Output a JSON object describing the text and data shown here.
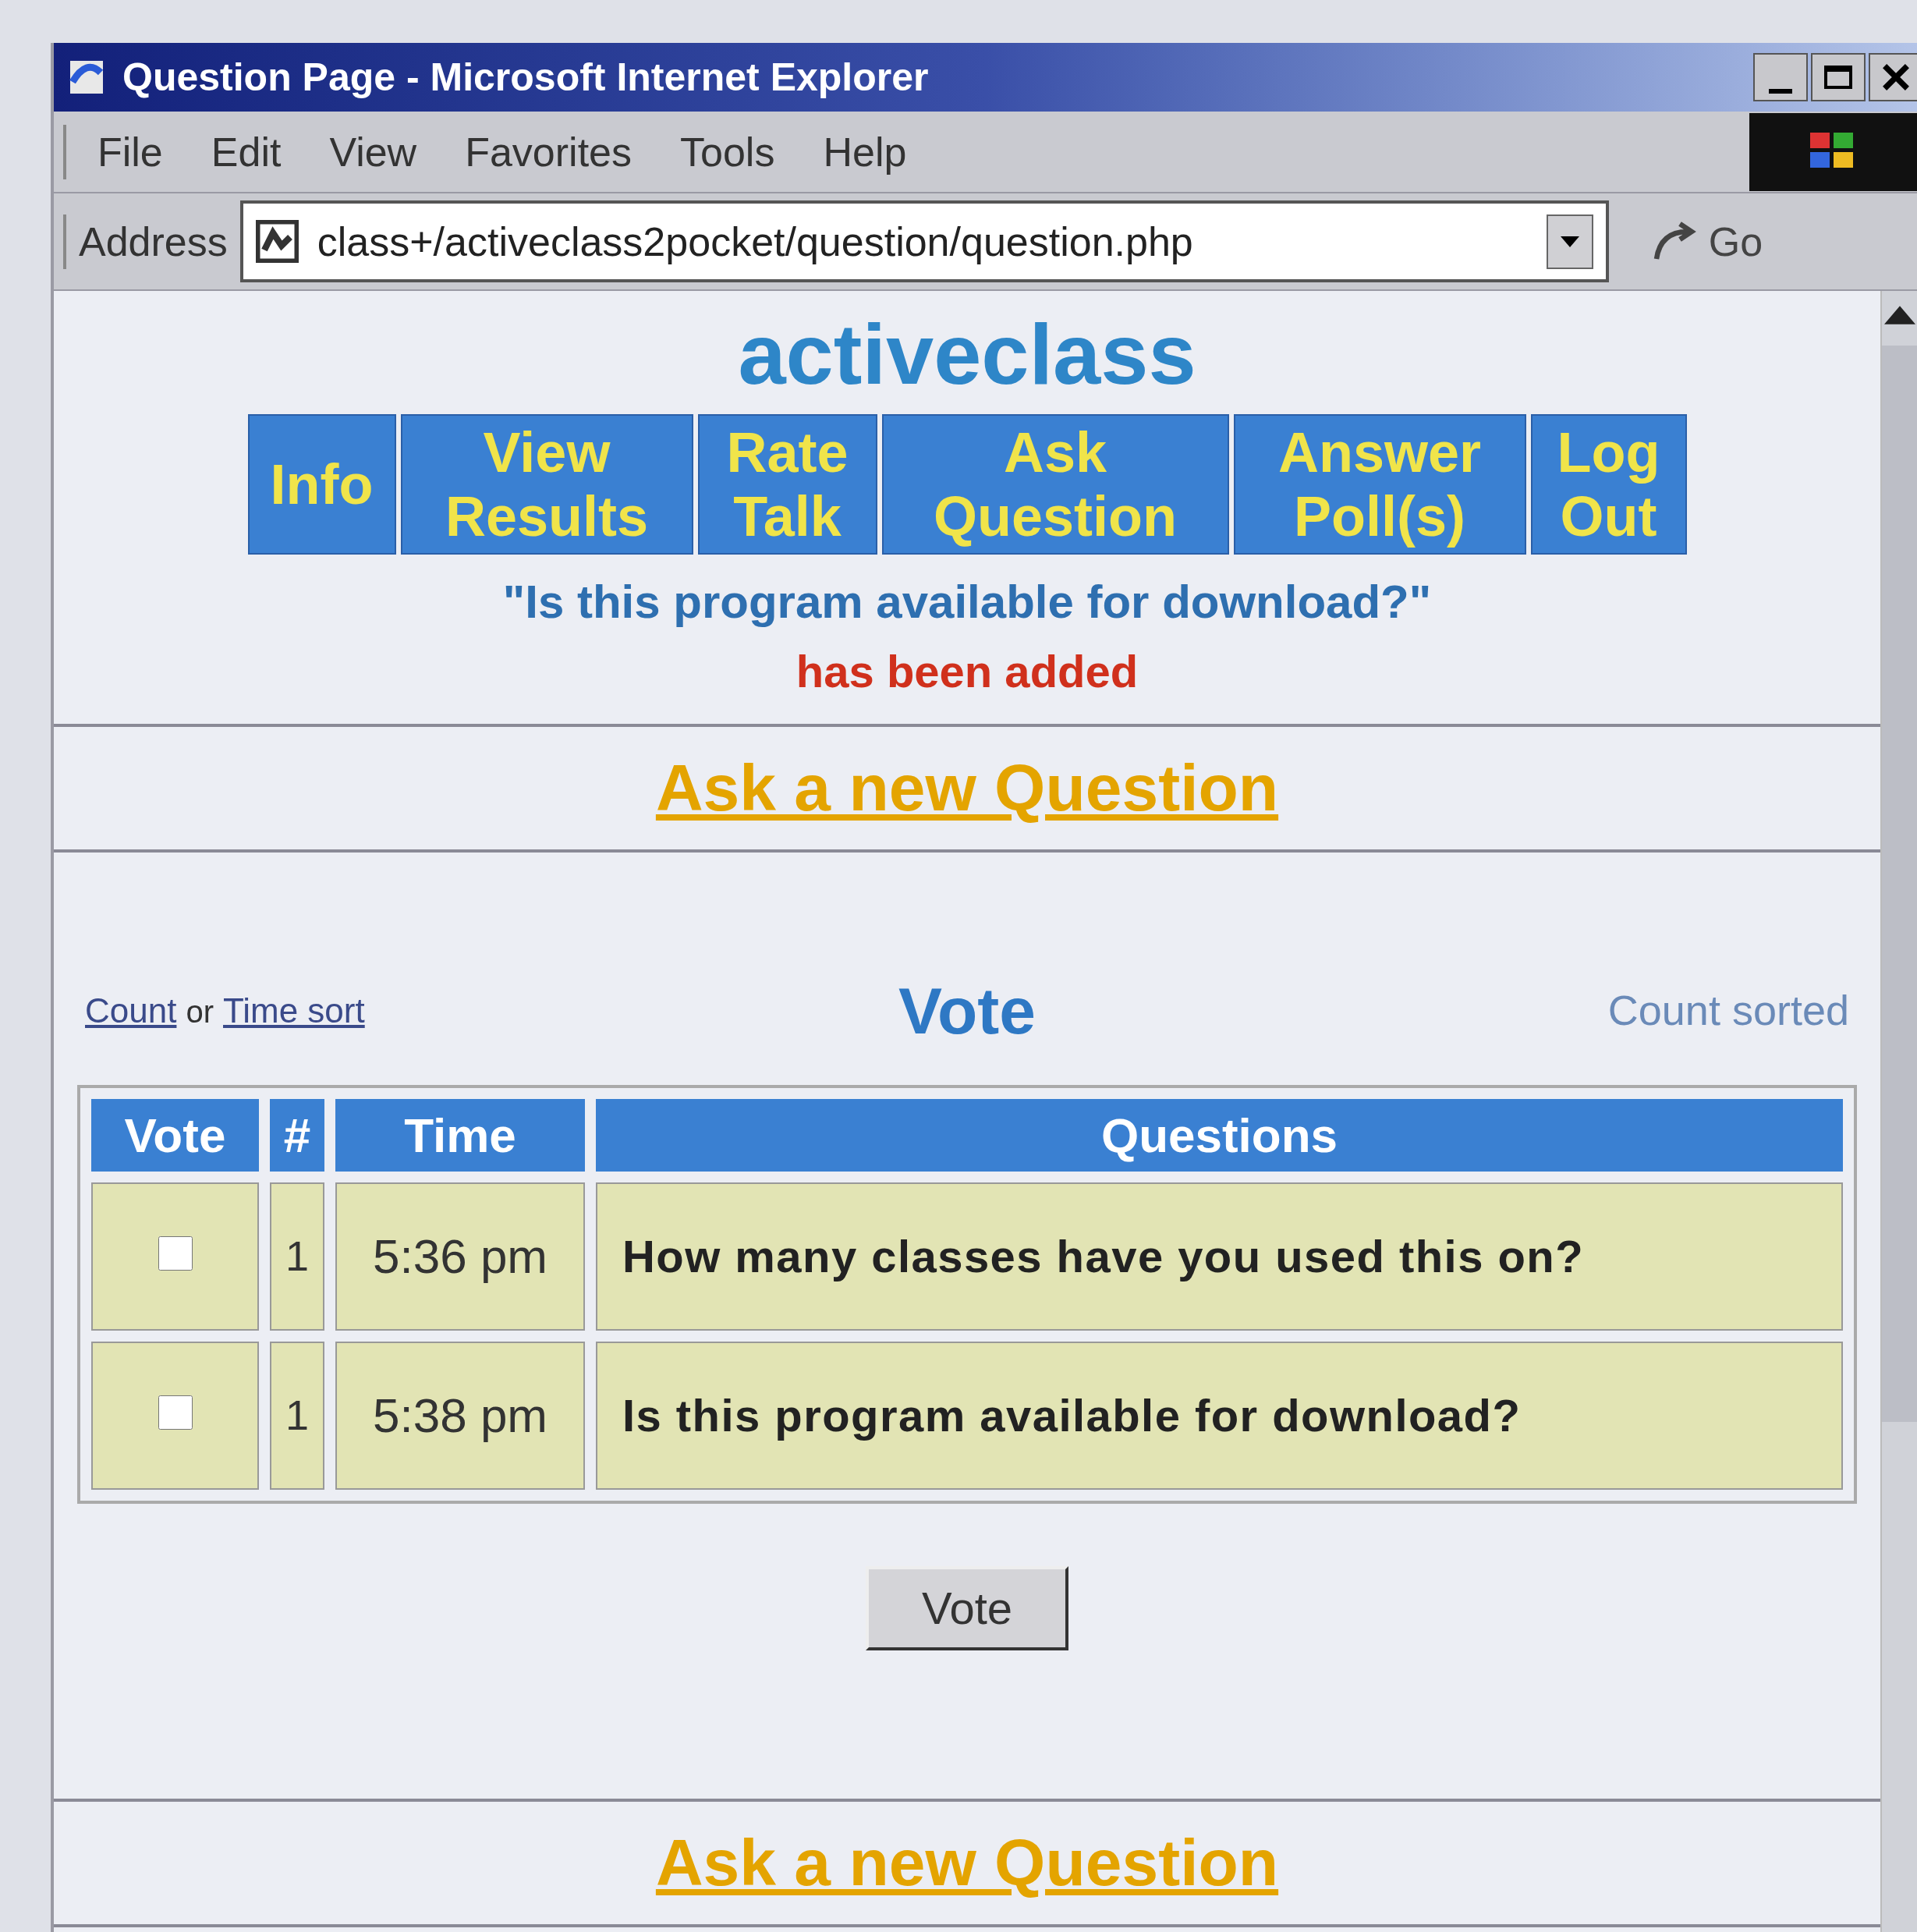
{
  "window": {
    "title": "Question Page - Microsoft Internet Explorer"
  },
  "menu": [
    "File",
    "Edit",
    "View",
    "Favorites",
    "Tools",
    "Help"
  ],
  "address_bar": {
    "label": "Address",
    "value": "class+/activeclass2pocket/question/question.php",
    "go": "Go"
  },
  "page": {
    "logo": "activeclass",
    "nav": [
      "Info",
      "View Results",
      "Rate Talk",
      "Ask Question",
      "Answer Poll(s)",
      "Log Out"
    ],
    "added_question": "\"Is this program available for download?\"",
    "added_status": "has been added",
    "ask_link": "Ask a new Question",
    "sort": {
      "count_link": "Count",
      "or": "or",
      "time_link": "Time sort"
    },
    "vote_heading": "Vote",
    "sort_status": "Count sorted",
    "table": {
      "columns": [
        "Vote",
        "#",
        "Time",
        "Questions"
      ],
      "rows": [
        {
          "checked": false,
          "count": "1",
          "time": "5:36 pm",
          "question": "How many classes have you used this on?"
        },
        {
          "checked": false,
          "count": "1",
          "time": "5:38 pm",
          "question": "Is this program available for download?"
        }
      ]
    },
    "vote_button": "Vote",
    "ask_link_bottom": "Ask a new Question"
  }
}
